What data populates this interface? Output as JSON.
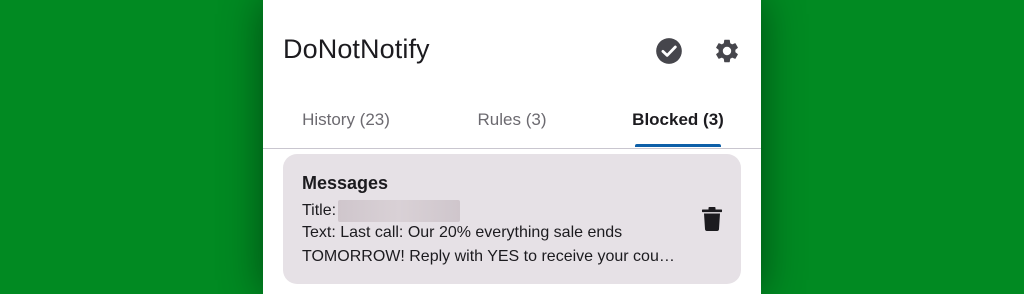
{
  "background_color": "#018a22",
  "app": {
    "title": "DoNotNotify",
    "actions": [
      {
        "icon": "check-circle-icon"
      },
      {
        "icon": "gear-icon"
      }
    ]
  },
  "tabs": [
    {
      "label": "History (23)",
      "active": false
    },
    {
      "label": "Rules (3)",
      "active": false
    },
    {
      "label": "Blocked (3)",
      "active": true
    }
  ],
  "accent_color": "#0d5fa8",
  "blocked": [
    {
      "app_name": "Messages",
      "title_label": "Title:",
      "text_line1": "Text: Last call: Our 20% everything sale ends",
      "text_line2": "TOMORROW! Reply with YES to receive your cou…",
      "delete_icon": "trash-icon"
    }
  ]
}
